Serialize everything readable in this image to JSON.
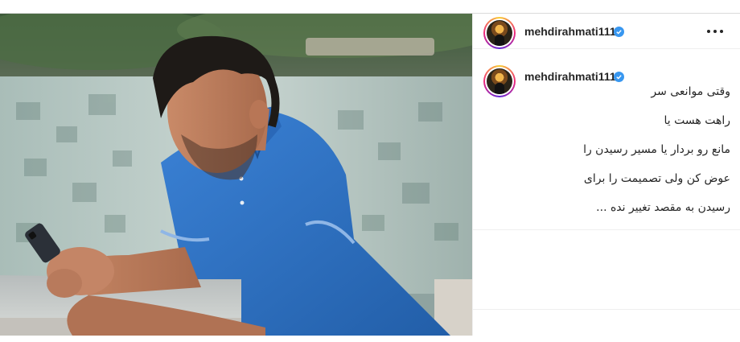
{
  "post": {
    "author": {
      "username": "mehdirahmati111",
      "verified": true,
      "avatar_icon": "profile-avatar"
    },
    "caption": {
      "lines": [
        "وقتی موانعی سر",
        "راهت هست یا",
        "مانع رو بردار یا مسیر رسیدن را",
        "عوض کن ولی تصمیمت را برای",
        "رسیدن به مقصد تغییر نده ..."
      ]
    },
    "menu_icon": "more-options-icon"
  },
  "colors": {
    "verified_badge": "#3897f0",
    "text": "#262626",
    "shirt": "#2f6fc0",
    "border": "#dbdbdb"
  }
}
